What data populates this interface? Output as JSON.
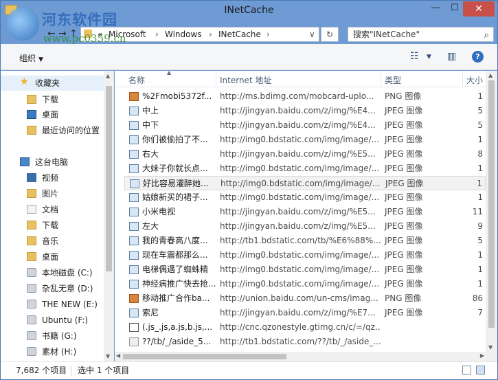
{
  "window": {
    "title": "INetCache",
    "minimize": "—",
    "maximize": "☐",
    "close": "✕"
  },
  "watermark": {
    "text": "河东软件园",
    "url": "www.pc0359.cn"
  },
  "nav": {
    "back": "←",
    "forward": "→",
    "up": "↑"
  },
  "address": {
    "overflow": "«",
    "crumbs": [
      "Microsoft",
      "Windows",
      "INetCache"
    ],
    "separator": "›",
    "dropdown": "∨",
    "refresh": "↻"
  },
  "search": {
    "placeholder": "搜索\"INetCache\"",
    "icon": "search-icon"
  },
  "toolbar": {
    "organize": "组织",
    "view_icon": "view-details-icon",
    "preview_icon": "preview-pane-icon",
    "help": "?"
  },
  "sidebar": {
    "favorites": "收藏夹",
    "fav_items": [
      "下载",
      "桌面",
      "最近访问的位置"
    ],
    "this_pc": "这台电脑",
    "pc_items": [
      "视频",
      "图片",
      "文档",
      "下载",
      "音乐",
      "桌面"
    ],
    "drives": [
      "本地磁盘 (C:)",
      "杂乱无章 (D:)",
      "THE NEW (E:)",
      "Ubuntu (F:)",
      "书籍 (G:)",
      "素材 (H:)"
    ]
  },
  "columns": {
    "name": "名称",
    "url": "Internet 地址",
    "type": "类型",
    "size": "大小"
  },
  "files": [
    {
      "name": "%2Fmobi5372f...",
      "url": "http://ms.bdimg.com/mobcard-uplo...",
      "type": "PNG 图像",
      "size": "1",
      "icon": "png"
    },
    {
      "name": "中上",
      "url": "http://jingyan.baidu.com/z/img/%E4...",
      "type": "JPEG 图像",
      "size": "5",
      "icon": "jpg"
    },
    {
      "name": "中下",
      "url": "http://jingyan.baidu.com/z/img/%E4...",
      "type": "JPEG 图像",
      "size": "5",
      "icon": "jpg"
    },
    {
      "name": "你们被偷拍了不...",
      "url": "http://img0.bdstatic.com/img/image/...",
      "type": "JPEG 图像",
      "size": "1",
      "icon": "jpg"
    },
    {
      "name": "右大",
      "url": "http://jingyan.baidu.com/z/img/%E5...",
      "type": "JPEG 图像",
      "size": "8",
      "icon": "jpg"
    },
    {
      "name": "大妹子你就长点...",
      "url": "http://img0.bdstatic.com/img/image/...",
      "type": "JPEG 图像",
      "size": "1",
      "icon": "jpg"
    },
    {
      "name": "好比容易灌醉她...",
      "url": "http://img0.bdstatic.com/img/image/...",
      "type": "JPEG 图像",
      "size": "1",
      "icon": "jpg"
    },
    {
      "name": "姑娘新买的裙子...",
      "url": "http://img0.bdstatic.com/img/image/...",
      "type": "JPEG 图像",
      "size": "1",
      "icon": "jpg"
    },
    {
      "name": "小米电视",
      "url": "http://jingyan.baidu.com/z/img/%E5...",
      "type": "JPEG 图像",
      "size": "11",
      "icon": "jpg"
    },
    {
      "name": "左大",
      "url": "http://jingyan.baidu.com/z/img/%E5...",
      "type": "JPEG 图像",
      "size": "9",
      "icon": "jpg"
    },
    {
      "name": "我的青春高八度...",
      "url": "http://tb1.bdstatic.com/tb/%E6%88%...",
      "type": "JPEG 图像",
      "size": "5",
      "icon": "jpg"
    },
    {
      "name": "现在车震都那么...",
      "url": "http://img0.bdstatic.com/img/image/...",
      "type": "JPEG 图像",
      "size": "1",
      "icon": "jpg"
    },
    {
      "name": "电梯偶遇了蜘蛛精",
      "url": "http://img0.bdstatic.com/img/image/...",
      "type": "JPEG 图像",
      "size": "1",
      "icon": "jpg"
    },
    {
      "name": "神经病推广快去抢...",
      "url": "http://img0.bdstatic.com/img/image/...",
      "type": "JPEG 图像",
      "size": "1",
      "icon": "jpg"
    },
    {
      "name": "移动推广合作ba...",
      "url": "http://union.baidu.com/un-cms/imag...",
      "type": "PNG 图像",
      "size": "86",
      "icon": "png"
    },
    {
      "name": "索尼",
      "url": "http://jingyan.baidu.com/z/img/%E7...",
      "type": "JPEG 图像",
      "size": "7",
      "icon": "jpg"
    },
    {
      "name": "(.js_.js,a.js,b.js,...",
      "url": "http://cnc.qzonestyle.gtimg.cn/c/=/qz...",
      "type": "",
      "size": "",
      "icon": "js"
    },
    {
      "name": "??/tb/_/aside_5...",
      "url": "http://tb1.bdstatic.com/??/tb/_/aside_...",
      "type": "",
      "size": "",
      "icon": "unk"
    }
  ],
  "status": {
    "count": "7,682 个项目",
    "selected": "选中 1 个项目"
  }
}
